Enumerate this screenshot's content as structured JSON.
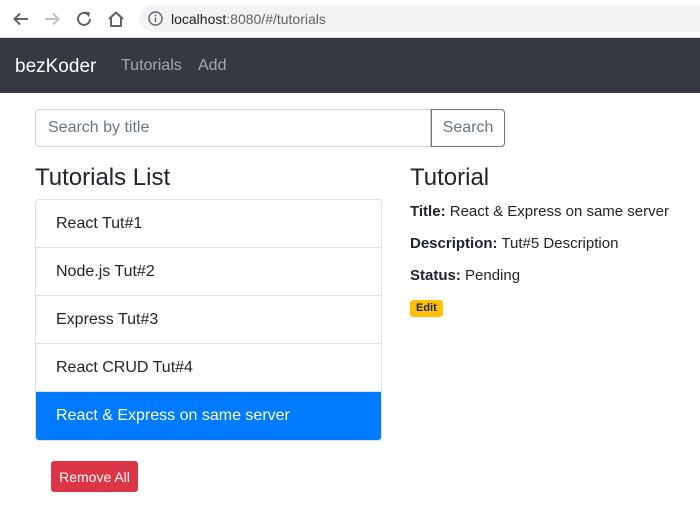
{
  "browser": {
    "url_host": "localhost",
    "url_rest": ":8080/#/tutorials"
  },
  "navbar": {
    "brand": "bezKoder",
    "links": [
      "Tutorials",
      "Add"
    ]
  },
  "search": {
    "placeholder": "Search by title",
    "value": "",
    "button_label": "Search"
  },
  "list": {
    "title": "Tutorials List",
    "items": [
      "React Tut#1",
      "Node.js Tut#2",
      "Express Tut#3",
      "React CRUD Tut#4",
      "React & Express on same server"
    ],
    "active_index": 4,
    "remove_all_label": "Remove All"
  },
  "detail": {
    "title": "Tutorial",
    "title_label": "Title:",
    "title_value": "React & Express on same server",
    "description_label": "Description:",
    "description_value": "Tut#5 Description",
    "status_label": "Status:",
    "status_value": "Pending",
    "edit_label": "Edit"
  },
  "colors": {
    "navbar_bg": "#343a40",
    "active_item": "#007bff",
    "danger": "#dc3545",
    "warning": "#ffc107"
  },
  "icons": [
    "back-arrow-icon",
    "forward-arrow-icon",
    "reload-icon",
    "home-icon",
    "info-icon"
  ]
}
